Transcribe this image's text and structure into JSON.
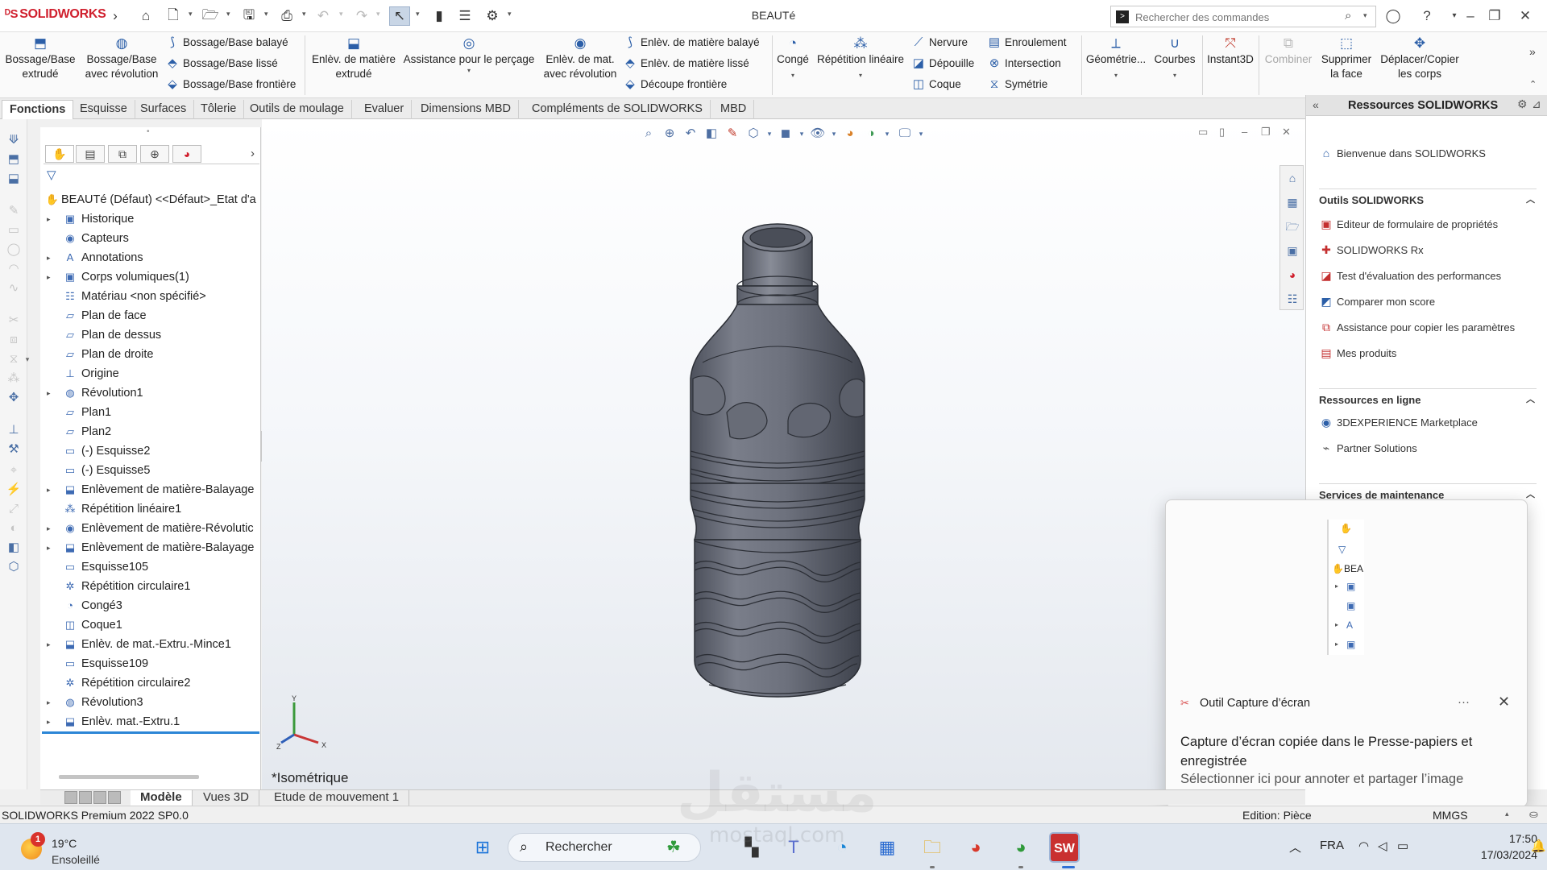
{
  "app": {
    "brand": "SOLIDWORKS",
    "document_title": "BEAUTé",
    "command_search": {
      "placeholder": "Rechercher des commandes"
    }
  },
  "ribbon": {
    "bossage_extrude": "Bossage/Base\nextrudé",
    "bossage_revolution": "Bossage/Base\navec révolution",
    "bossage_balaye": "Bossage/Base balayé",
    "bossage_lisse": "Bossage/Base lissé",
    "bossage_frontiere": "Bossage/Base frontière",
    "enlev_extrude": "Enlèv. de matière\nextrudé",
    "assistance_percage": "Assistance pour le perçage",
    "enlev_revolution": "Enlèv. de mat.\navec révolution",
    "enlev_balaye": "Enlèv. de matière balayé",
    "enlev_lisse": "Enlèv. de matière lissé",
    "decoupe_frontiere": "Découpe frontière",
    "conge": "Congé",
    "repetition_lineaire": "Répétition linéaire",
    "nervure": "Nervure",
    "depouille": "Dépouille",
    "coque": "Coque",
    "enroulement": "Enroulement",
    "intersection": "Intersection",
    "symetrie": "Symétrie",
    "geometrie": "Géométrie...",
    "courbes": "Courbes",
    "instant3d": "Instant3D",
    "combiner": "Combiner",
    "supprimer_face": "Supprimer\nla face",
    "deplacer_corps": "Déplacer/Copier\nles corps"
  },
  "command_tabs": [
    "Fonctions",
    "Esquisse",
    "Surfaces",
    "Tôlerie",
    "Outils de moulage",
    "Evaluer",
    "Dimensions MBD",
    "Compléments de SOLIDWORKS",
    "MBD"
  ],
  "feature_tree": {
    "root": "BEAUTé (Défaut) <<Défaut>_Etat d'a",
    "items": [
      {
        "label": "Historique",
        "expandable": true,
        "icon": "history-icon"
      },
      {
        "label": "Capteurs",
        "expandable": false,
        "icon": "sensor-icon"
      },
      {
        "label": "Annotations",
        "expandable": true,
        "icon": "annotation-icon"
      },
      {
        "label": "Corps volumiques(1)",
        "expandable": true,
        "icon": "solid-bodies-icon"
      },
      {
        "label": "Matériau <non spécifié>",
        "expandable": false,
        "icon": "material-icon"
      },
      {
        "label": "Plan de face",
        "expandable": false,
        "icon": "plane-icon"
      },
      {
        "label": "Plan de dessus",
        "expandable": false,
        "icon": "plane-icon"
      },
      {
        "label": "Plan de droite",
        "expandable": false,
        "icon": "plane-icon"
      },
      {
        "label": "Origine",
        "expandable": false,
        "icon": "origin-icon"
      },
      {
        "label": "Révolution1",
        "expandable": true,
        "icon": "revolve-icon"
      },
      {
        "label": "Plan1",
        "expandable": false,
        "icon": "plane-icon"
      },
      {
        "label": "Plan2",
        "expandable": false,
        "icon": "plane-icon"
      },
      {
        "label": "(-) Esquisse2",
        "expandable": false,
        "icon": "sketch-icon"
      },
      {
        "label": "(-) Esquisse5",
        "expandable": false,
        "icon": "sketch-icon"
      },
      {
        "label": "Enlèvement de matière-Balayage",
        "expandable": true,
        "icon": "swept-cut-icon"
      },
      {
        "label": "Répétition linéaire1",
        "expandable": false,
        "icon": "linear-pattern-icon"
      },
      {
        "label": "Enlèvement de matière-Révolutic",
        "expandable": true,
        "icon": "revolved-cut-icon"
      },
      {
        "label": "Enlèvement de matière-Balayage",
        "expandable": true,
        "icon": "swept-cut-icon"
      },
      {
        "label": "Esquisse105",
        "expandable": false,
        "icon": "sketch-icon"
      },
      {
        "label": "Répétition circulaire1",
        "expandable": false,
        "icon": "circular-pattern-icon"
      },
      {
        "label": "Congé3",
        "expandable": false,
        "icon": "fillet-icon"
      },
      {
        "label": "Coque1",
        "expandable": false,
        "icon": "shell-icon"
      },
      {
        "label": "Enlèv. de mat.-Extru.-Mince1",
        "expandable": true,
        "icon": "extruded-cut-icon"
      },
      {
        "label": "Esquisse109",
        "expandable": false,
        "icon": "sketch-icon"
      },
      {
        "label": "Répétition circulaire2",
        "expandable": false,
        "icon": "circular-pattern-icon"
      },
      {
        "label": "Révolution3",
        "expandable": true,
        "icon": "revolve-icon"
      },
      {
        "label": "Enlèv. mat.-Extru.1",
        "expandable": true,
        "icon": "extruded-cut-icon"
      }
    ]
  },
  "viewport": {
    "view_name": "*Isométrique"
  },
  "taskpane": {
    "title": "Ressources SOLIDWORKS",
    "welcome": "Bienvenue dans SOLIDWORKS",
    "tools_header": "Outils SOLIDWORKS",
    "tools": [
      "Editeur de formulaire de propriétés",
      "SOLIDWORKS Rx",
      "Test d'évaluation des performances",
      "Comparer mon score",
      "Assistance pour copier les paramètres",
      "Mes produits"
    ],
    "online_header": "Ressources en ligne",
    "online": [
      "3DEXPERIENCE Marketplace",
      "Partner Solutions"
    ],
    "maintenance_header": "Services de maintenance"
  },
  "toast": {
    "app_name": "Outil Capture d’écran",
    "more": "···",
    "message": "Capture d’écran copiée dans le Presse-papiers et enregistrée",
    "sub": "Sélectionner ici pour annoter et partager l’image",
    "thumb_text": "BEA"
  },
  "model_tabs": [
    "Modèle",
    "Vues 3D",
    "Etude de mouvement 1"
  ],
  "status": {
    "version": "SOLIDWORKS Premium 2022 SP0.0",
    "edit_mode": "Edition: Pièce",
    "units": "MMGS"
  },
  "taskbar": {
    "weather_badge": "1",
    "temperature": "19°C",
    "condition": "Ensoleillé",
    "search_label": "Rechercher",
    "language": "FRA",
    "time": "17:50",
    "date": "17/03/2024"
  },
  "watermark": {
    "text": "مستقل",
    "url": "mostaql.com"
  },
  "colors": {
    "brand_red": "#d0202e",
    "accent_blue": "#2c86d6",
    "bottle_gray": "#6e7280"
  }
}
